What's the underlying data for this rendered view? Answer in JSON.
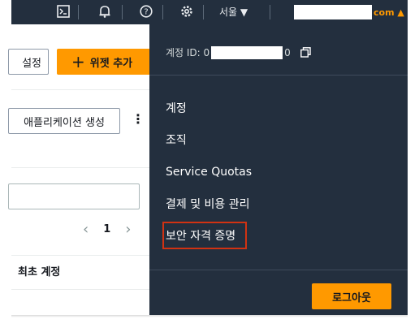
{
  "topbar": {
    "region_label": "서울 ▼",
    "account_suffix": "com ▲"
  },
  "console": {
    "settings_button": "설정",
    "add_widget_button": "위젯 추가",
    "create_app_button": "애플리케이션 생성",
    "more_icon": "⋮",
    "page_number": "1",
    "column_header": "최초 계정"
  },
  "account_menu": {
    "account_id_prefix": "계정 ID: 0",
    "account_id_suffix": "0",
    "items": [
      {
        "label": "계정"
      },
      {
        "label": "조직"
      },
      {
        "label": "Service Quotas"
      },
      {
        "label": "결제 및 비용 관리"
      },
      {
        "label": "보안 자격 증명"
      }
    ],
    "highlighted_item": "보안 자격 증명",
    "logout_button": "로그아웃"
  },
  "colors": {
    "nav_bg": "#232f3e",
    "accent": "#ff9900",
    "highlight_border": "#d13212"
  }
}
